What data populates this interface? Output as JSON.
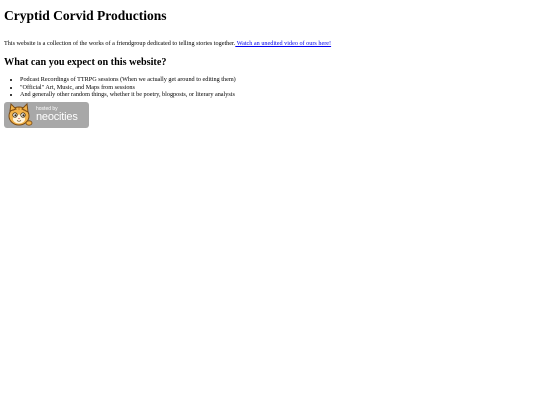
{
  "page": {
    "title": "Cryptid Corvid Productions",
    "intro_text": "This website is a collection of the works of a friendgroup dedicated to telling stories together.",
    "intro_link": " Watch an unedited video of ours here!",
    "subheading": "What can you expect on this website?",
    "list_items": [
      "Podcast Recordings of TTRPG sessions (When we actually get around to editing them)",
      "\"Official\" Art, Music, and Maps from sessions",
      "And generally other random things, whether it be poetry, blogposts, or literary analysis"
    ]
  },
  "badge": {
    "hosted_by": "hosted by",
    "brand": "neocities",
    "icon": "neocities-cat-icon"
  }
}
